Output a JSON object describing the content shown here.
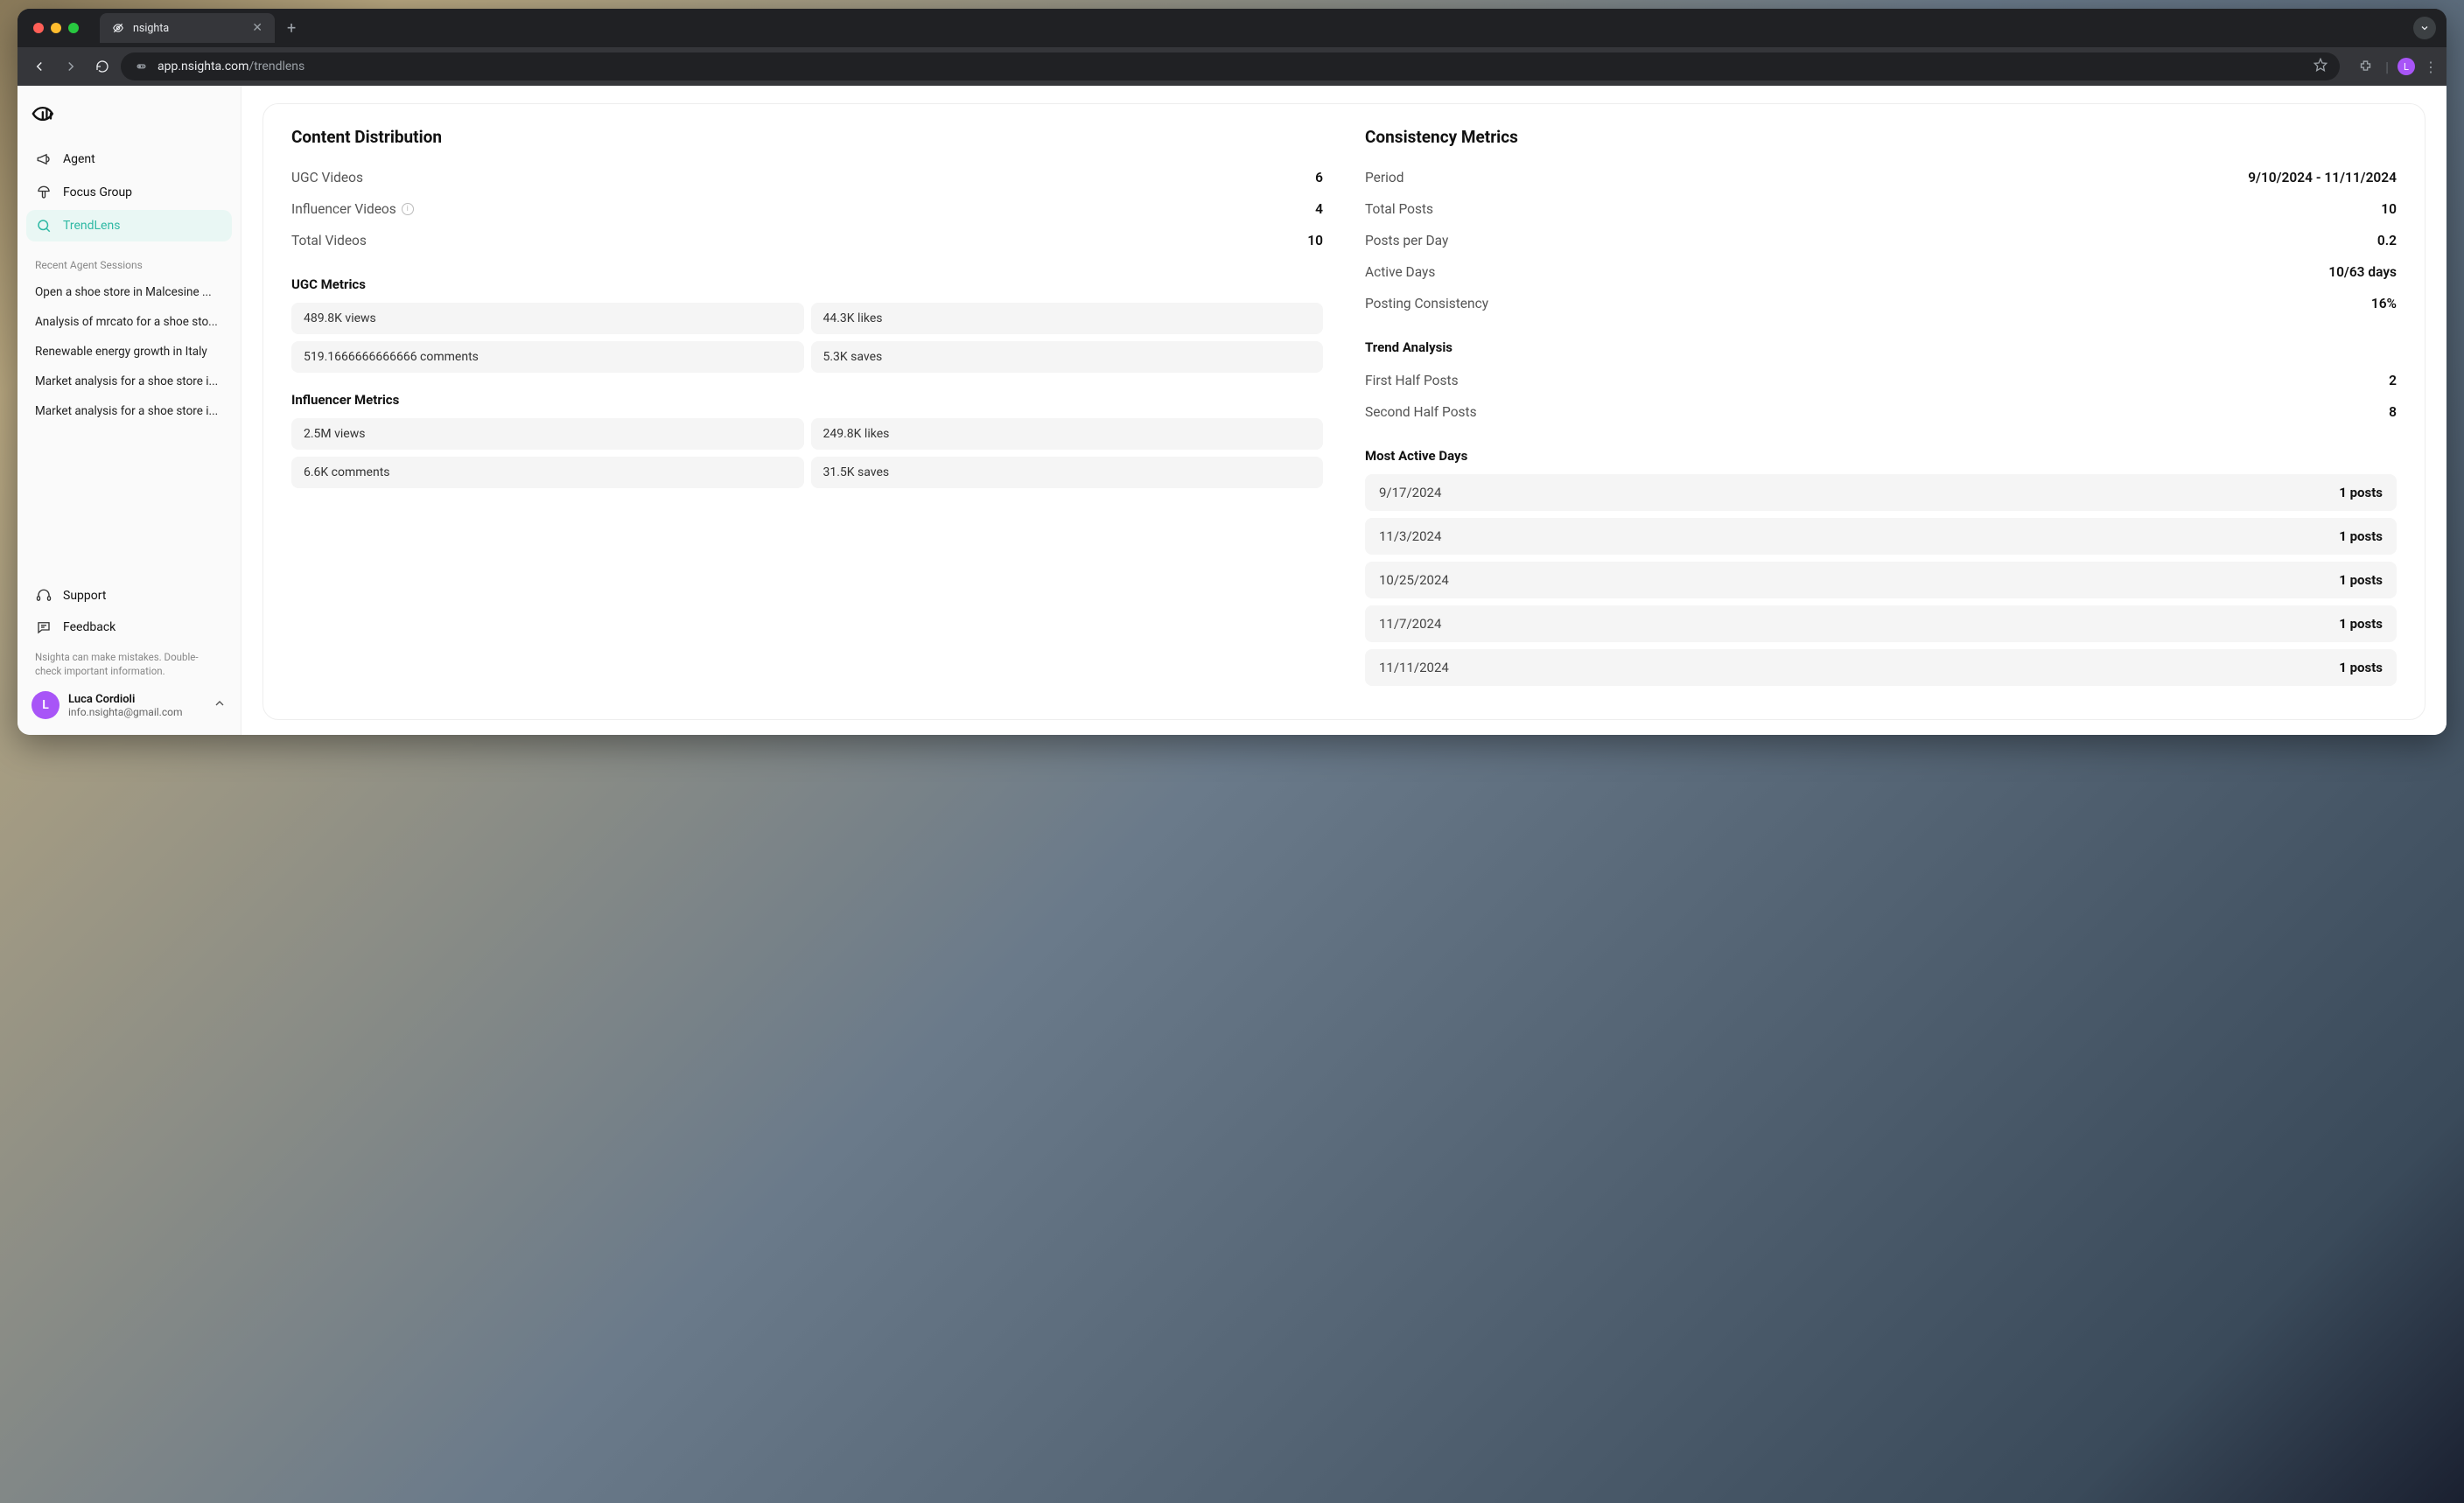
{
  "browser": {
    "tab_title": "nsighta",
    "url_host": "app.nsighta.com",
    "url_path": "/trendlens",
    "profile_initial": "L"
  },
  "sidebar": {
    "nav": [
      {
        "label": "Agent",
        "icon": "megaphone-icon"
      },
      {
        "label": "Focus Group",
        "icon": "mushroom-icon"
      },
      {
        "label": "TrendLens",
        "icon": "search-icon"
      }
    ],
    "recent_label": "Recent Agent Sessions",
    "sessions": [
      "Open a shoe store in Malcesine ...",
      "Analysis of mrcato for a shoe sto...",
      "Renewable energy growth in Italy",
      "Market analysis for a shoe store i...",
      "Market analysis for a shoe store i..."
    ],
    "support_label": "Support",
    "feedback_label": "Feedback",
    "disclaimer": "Nsighta can make mistakes. Double-check important information.",
    "user": {
      "initial": "L",
      "name": "Luca Cordioli",
      "email": "info.nsighta@gmail.com"
    }
  },
  "content_distribution": {
    "title": "Content Distribution",
    "rows": [
      {
        "label": "UGC Videos",
        "value": "6"
      },
      {
        "label": "Influencer Videos",
        "value": "4",
        "info": true
      },
      {
        "label": "Total Videos",
        "value": "10"
      }
    ],
    "ugc_title": "UGC Metrics",
    "ugc_metrics": [
      "489.8K views",
      "44.3K likes",
      "519.1666666666666 comments",
      "5.3K saves"
    ],
    "influencer_title": "Influencer Metrics",
    "influencer_metrics": [
      "2.5M views",
      "249.8K likes",
      "6.6K comments",
      "31.5K saves"
    ]
  },
  "consistency": {
    "title": "Consistency Metrics",
    "rows": [
      {
        "label": "Period",
        "value": "9/10/2024 - 11/11/2024"
      },
      {
        "label": "Total Posts",
        "value": "10"
      },
      {
        "label": "Posts per Day",
        "value": "0.2"
      },
      {
        "label": "Active Days",
        "value": "10/63 days"
      },
      {
        "label": "Posting Consistency",
        "value": "16%"
      }
    ],
    "trend_title": "Trend Analysis",
    "trend_rows": [
      {
        "label": "First Half Posts",
        "value": "2"
      },
      {
        "label": "Second Half Posts",
        "value": "8"
      }
    ],
    "active_title": "Most Active Days",
    "active_days": [
      {
        "date": "9/17/2024",
        "count": "1 posts"
      },
      {
        "date": "11/3/2024",
        "count": "1 posts"
      },
      {
        "date": "10/25/2024",
        "count": "1 posts"
      },
      {
        "date": "11/7/2024",
        "count": "1 posts"
      },
      {
        "date": "11/11/2024",
        "count": "1 posts"
      }
    ]
  }
}
